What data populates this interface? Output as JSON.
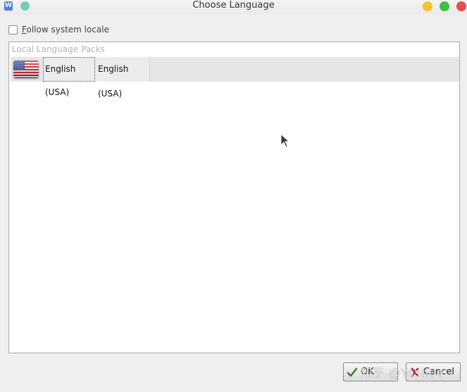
{
  "window": {
    "title": "Choose Language",
    "app_icon_letter": "W"
  },
  "options": {
    "follow_locale_mnemonic": "F",
    "follow_locale_rest": "ollow system locale",
    "follow_locale_checked": false
  },
  "panel": {
    "header": "Local Language Packs",
    "rows": [
      {
        "flag": "us-flag-icon",
        "name": "English (USA)",
        "native_name": "English (USA)"
      }
    ]
  },
  "buttons": {
    "ok_label": "OK",
    "cancel_label": "Cancel"
  },
  "watermark": {
    "text": "知乎 @Yoshua"
  },
  "colors": {
    "minimize": "#f6c12a",
    "maximize": "#3fbf45",
    "close": "#ec4b4b",
    "pin": "#72cbbf",
    "selected_row": "#e6e6e6"
  }
}
